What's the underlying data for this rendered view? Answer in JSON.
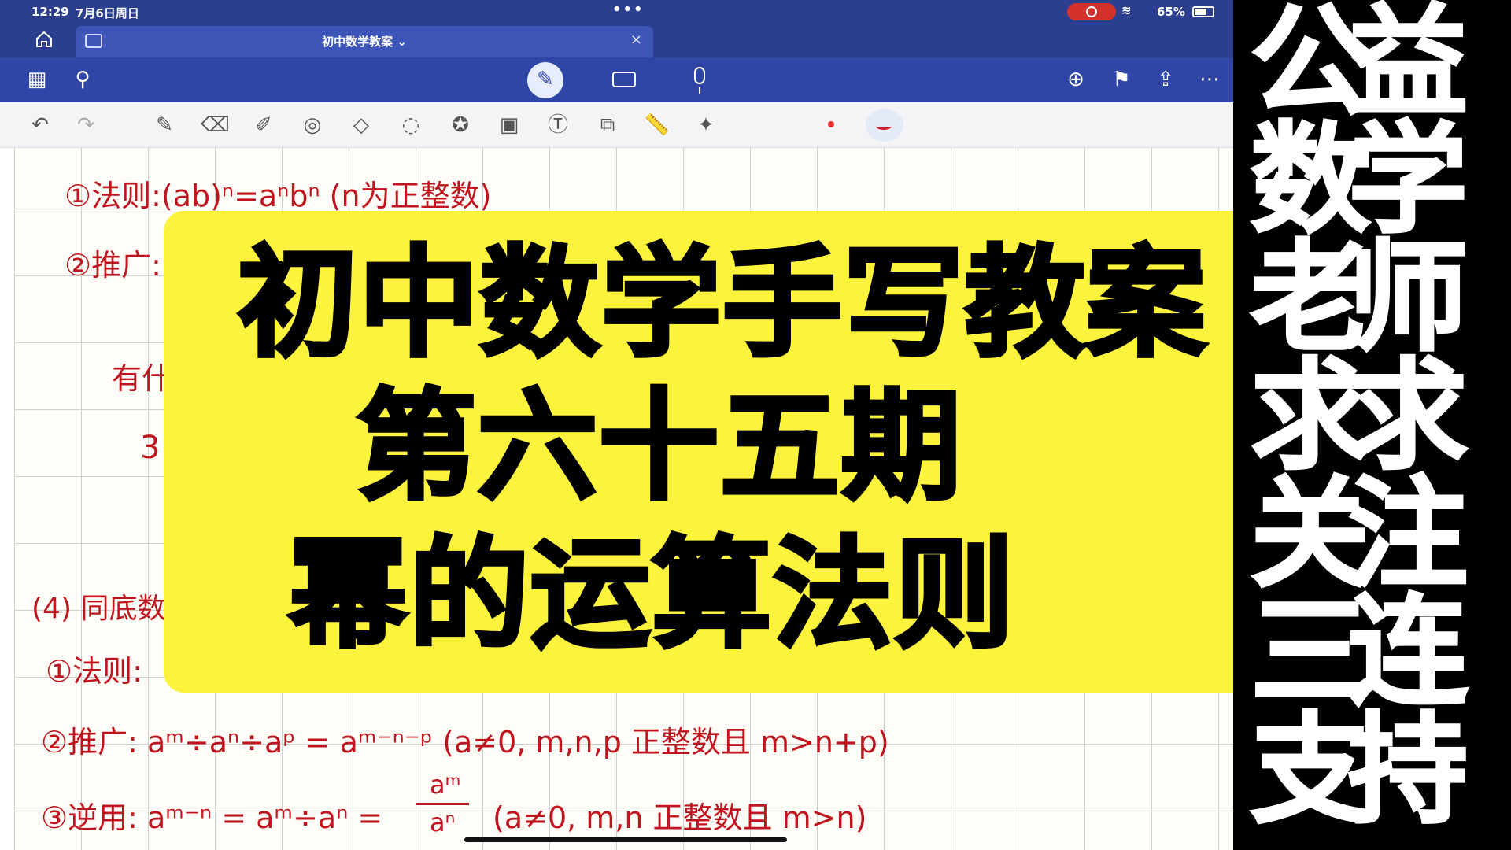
{
  "status_bar": {
    "time": "12:29",
    "date": "7月6日周日",
    "battery": "65%"
  },
  "tab": {
    "title": "初中数学教案 ⌄",
    "close": "×"
  },
  "title_card": {
    "line1": "初中数学手写教案",
    "line2": "第六十五期",
    "line3": "幂的运算法则"
  },
  "notes": {
    "rule_line": "①法则:(ab)ⁿ=aⁿbⁿ (n为正整数)",
    "infer_partial": "②推广:",
    "what_partial": "有什",
    "three_partial": "3",
    "section4_partial": "(4) 同底数",
    "rule2_partial": "①法则:",
    "infer2": "②推广: aᵐ÷aⁿ÷aᵖ = aᵐ⁻ⁿ⁻ᵖ (a≠0, m,n,p 正整数且 m>n+p)",
    "converse_lhs": "③逆用: aᵐ⁻ⁿ = aᵐ÷aⁿ =",
    "converse_num": "aᵐ",
    "converse_den": "aⁿ",
    "converse_cond": "(a≠0, m,n 正整数且 m>n)"
  },
  "promo": {
    "lines": [
      "公益",
      "数学",
      "老师",
      "求求",
      "关注",
      "三连",
      "支持"
    ]
  },
  "colors": {
    "ink": "#c0141f",
    "title_bg": "#fdf23c",
    "toolbar": "#2f46a6"
  }
}
